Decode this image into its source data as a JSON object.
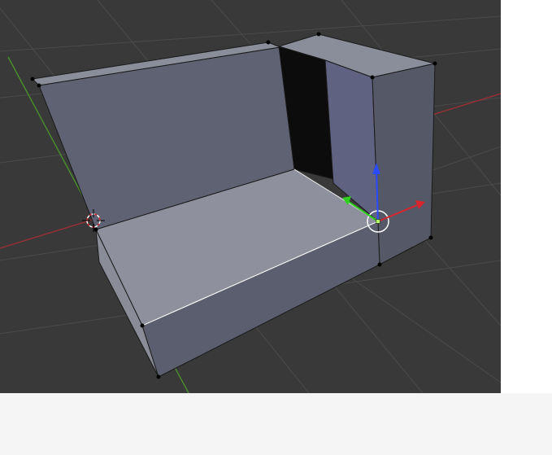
{
  "viewport": {
    "mode": "edit-mode",
    "colors": {
      "background": "#393939",
      "grid": "#4a4a4a",
      "x_axis": "#9a2f34",
      "y_axis": "#4a8f2a",
      "face": "#5b5e6e",
      "selected_edge": "#ffffff",
      "gizmo_x": "#d9262e",
      "gizmo_y": "#2fcf1f",
      "gizmo_z": "#2a4bff"
    },
    "icons": [
      "3d-cursor-icon",
      "transform-gizmo-icon"
    ]
  }
}
